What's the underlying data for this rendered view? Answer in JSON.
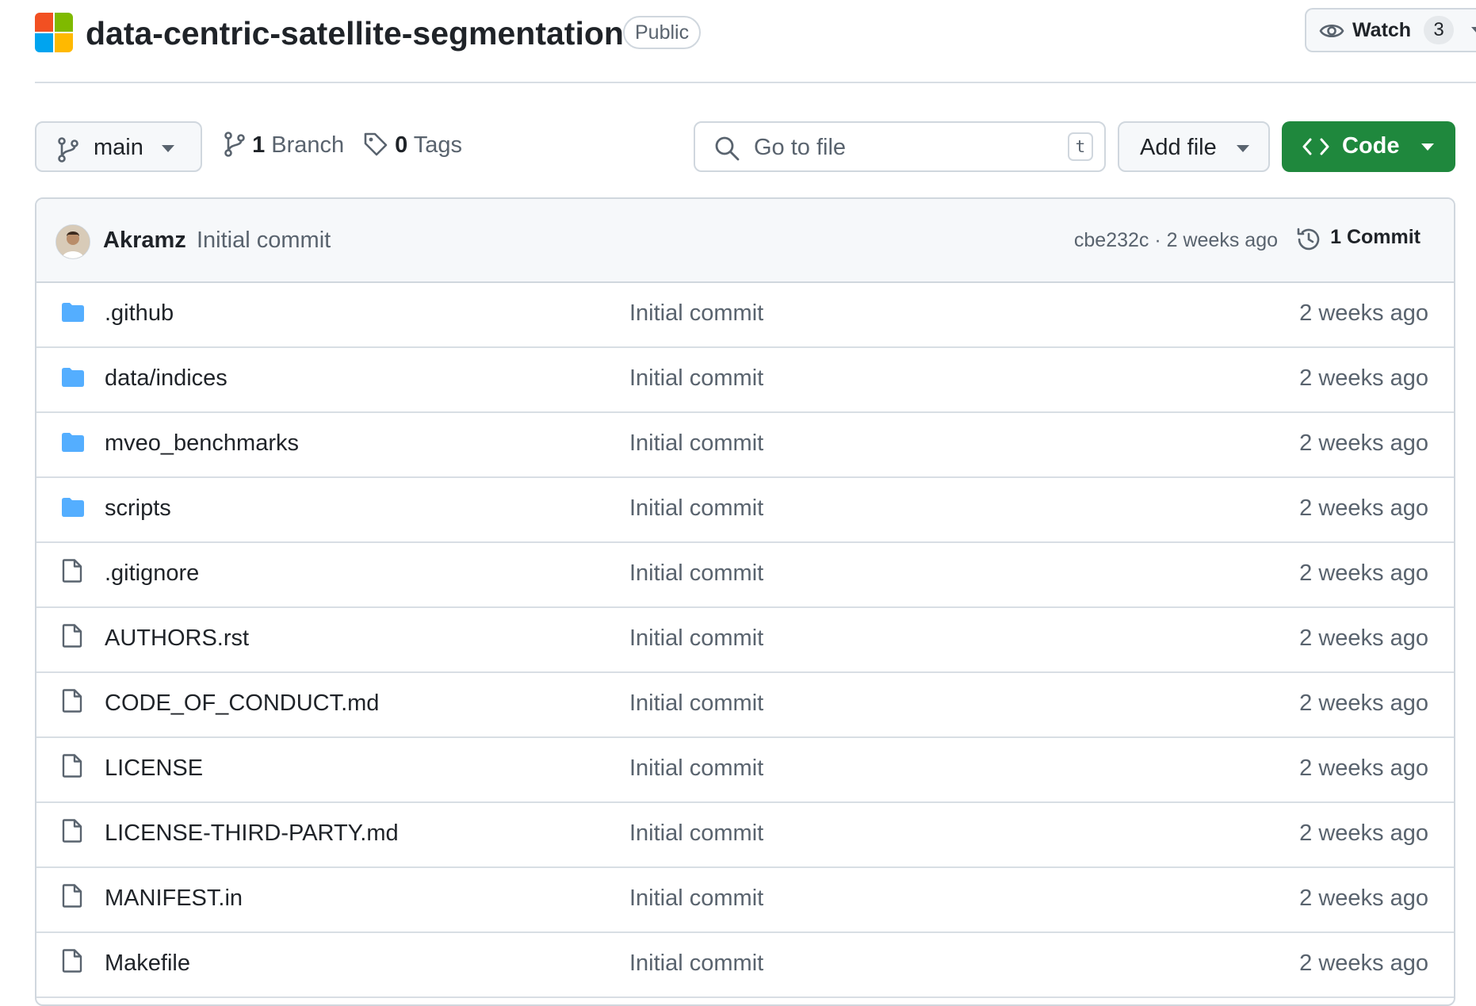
{
  "repo": {
    "name": "data-centric-satellite-segmentation",
    "visibility": "Public",
    "logo_colors": [
      "#f25022",
      "#7fba00",
      "#00a4ef",
      "#ffb900"
    ]
  },
  "watch": {
    "label": "Watch",
    "count": "3"
  },
  "toolbar": {
    "branch": "main",
    "branch_count": "1",
    "branch_label": "Branch",
    "tag_count": "0",
    "tag_label": "Tags",
    "search_placeholder": "Go to file",
    "search_shortcut": "t",
    "add_file_label": "Add file",
    "code_label": "Code"
  },
  "latest_commit": {
    "author": "Akramz",
    "message": "Initial commit",
    "meta": "cbe232c · 2 weeks ago",
    "commit_count_label": "1 Commit"
  },
  "files": [
    {
      "name": ".github",
      "type": "folder",
      "message": "Initial commit",
      "date": "2 weeks ago"
    },
    {
      "name": "data/indices",
      "type": "folder",
      "message": "Initial commit",
      "date": "2 weeks ago"
    },
    {
      "name": "mveo_benchmarks",
      "type": "folder",
      "message": "Initial commit",
      "date": "2 weeks ago"
    },
    {
      "name": "scripts",
      "type": "folder",
      "message": "Initial commit",
      "date": "2 weeks ago"
    },
    {
      "name": ".gitignore",
      "type": "file",
      "message": "Initial commit",
      "date": "2 weeks ago"
    },
    {
      "name": "AUTHORS.rst",
      "type": "file",
      "message": "Initial commit",
      "date": "2 weeks ago"
    },
    {
      "name": "CODE_OF_CONDUCT.md",
      "type": "file",
      "message": "Initial commit",
      "date": "2 weeks ago"
    },
    {
      "name": "LICENSE",
      "type": "file",
      "message": "Initial commit",
      "date": "2 weeks ago"
    },
    {
      "name": "LICENSE-THIRD-PARTY.md",
      "type": "file",
      "message": "Initial commit",
      "date": "2 weeks ago"
    },
    {
      "name": "MANIFEST.in",
      "type": "file",
      "message": "Initial commit",
      "date": "2 weeks ago"
    },
    {
      "name": "Makefile",
      "type": "file",
      "message": "Initial commit",
      "date": "2 weeks ago"
    }
  ],
  "colors": {
    "folder": "#54aeff",
    "code_button": "#1f883d",
    "muted_text": "#59636e",
    "border": "#d0d7de"
  }
}
